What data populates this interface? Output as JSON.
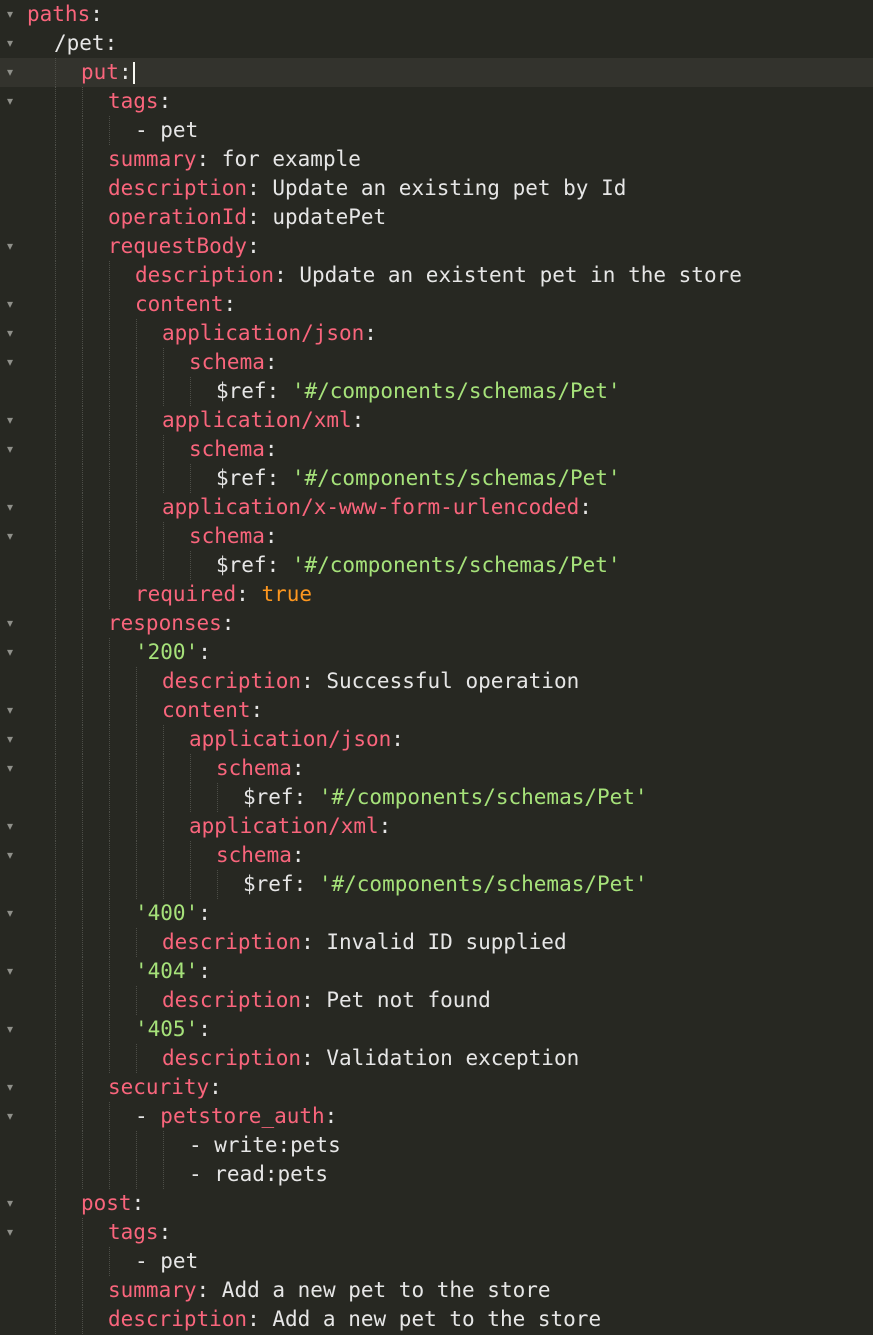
{
  "editor": {
    "language": "yaml",
    "theme": {
      "background": "#272822",
      "key": "#f9657c",
      "string": "#a6e27a",
      "boolean": "#fd971f",
      "text": "#e6e6e6"
    },
    "cursor_line": 2,
    "lines": [
      {
        "indent": 0,
        "fold": true,
        "parts": [
          {
            "t": "k",
            "v": "paths"
          },
          {
            "t": "p",
            "v": ":"
          }
        ]
      },
      {
        "indent": 1,
        "fold": true,
        "parts": [
          {
            "t": "p",
            "v": "/pet:"
          }
        ]
      },
      {
        "indent": 2,
        "fold": true,
        "parts": [
          {
            "t": "k",
            "v": "put"
          },
          {
            "t": "p",
            "v": ":"
          }
        ]
      },
      {
        "indent": 3,
        "fold": true,
        "parts": [
          {
            "t": "k",
            "v": "tags"
          },
          {
            "t": "p",
            "v": ":"
          }
        ]
      },
      {
        "indent": 4,
        "fold": false,
        "parts": [
          {
            "t": "p",
            "v": "- pet"
          }
        ]
      },
      {
        "indent": 3,
        "fold": false,
        "parts": [
          {
            "t": "k",
            "v": "summary"
          },
          {
            "t": "p",
            "v": ": for example"
          }
        ]
      },
      {
        "indent": 3,
        "fold": false,
        "parts": [
          {
            "t": "k",
            "v": "description"
          },
          {
            "t": "p",
            "v": ": Update an existing pet by Id"
          }
        ]
      },
      {
        "indent": 3,
        "fold": false,
        "parts": [
          {
            "t": "k",
            "v": "operationId"
          },
          {
            "t": "p",
            "v": ": updatePet"
          }
        ]
      },
      {
        "indent": 3,
        "fold": true,
        "parts": [
          {
            "t": "k",
            "v": "requestBody"
          },
          {
            "t": "p",
            "v": ":"
          }
        ]
      },
      {
        "indent": 4,
        "fold": false,
        "parts": [
          {
            "t": "k",
            "v": "description"
          },
          {
            "t": "p",
            "v": ": Update an existent pet in the store"
          }
        ]
      },
      {
        "indent": 4,
        "fold": true,
        "parts": [
          {
            "t": "k",
            "v": "content"
          },
          {
            "t": "p",
            "v": ":"
          }
        ]
      },
      {
        "indent": 5,
        "fold": true,
        "parts": [
          {
            "t": "k",
            "v": "application/json"
          },
          {
            "t": "p",
            "v": ":"
          }
        ]
      },
      {
        "indent": 6,
        "fold": true,
        "parts": [
          {
            "t": "k",
            "v": "schema"
          },
          {
            "t": "p",
            "v": ":"
          }
        ]
      },
      {
        "indent": 7,
        "fold": false,
        "parts": [
          {
            "t": "p",
            "v": "$ref: "
          },
          {
            "t": "s",
            "v": "'#/components/schemas/Pet'"
          }
        ]
      },
      {
        "indent": 5,
        "fold": true,
        "parts": [
          {
            "t": "k",
            "v": "application/xml"
          },
          {
            "t": "p",
            "v": ":"
          }
        ]
      },
      {
        "indent": 6,
        "fold": true,
        "parts": [
          {
            "t": "k",
            "v": "schema"
          },
          {
            "t": "p",
            "v": ":"
          }
        ]
      },
      {
        "indent": 7,
        "fold": false,
        "parts": [
          {
            "t": "p",
            "v": "$ref: "
          },
          {
            "t": "s",
            "v": "'#/components/schemas/Pet'"
          }
        ]
      },
      {
        "indent": 5,
        "fold": true,
        "parts": [
          {
            "t": "k",
            "v": "application/x-www-form-urlencoded"
          },
          {
            "t": "p",
            "v": ":"
          }
        ]
      },
      {
        "indent": 6,
        "fold": true,
        "parts": [
          {
            "t": "k",
            "v": "schema"
          },
          {
            "t": "p",
            "v": ":"
          }
        ]
      },
      {
        "indent": 7,
        "fold": false,
        "parts": [
          {
            "t": "p",
            "v": "$ref: "
          },
          {
            "t": "s",
            "v": "'#/components/schemas/Pet'"
          }
        ]
      },
      {
        "indent": 4,
        "fold": false,
        "parts": [
          {
            "t": "k",
            "v": "required"
          },
          {
            "t": "p",
            "v": ": "
          },
          {
            "t": "b",
            "v": "true"
          }
        ]
      },
      {
        "indent": 3,
        "fold": true,
        "parts": [
          {
            "t": "k",
            "v": "responses"
          },
          {
            "t": "p",
            "v": ":"
          }
        ]
      },
      {
        "indent": 4,
        "fold": true,
        "parts": [
          {
            "t": "s",
            "v": "'200'"
          },
          {
            "t": "p",
            "v": ":"
          }
        ]
      },
      {
        "indent": 5,
        "fold": false,
        "parts": [
          {
            "t": "k",
            "v": "description"
          },
          {
            "t": "p",
            "v": ": Successful operation"
          }
        ]
      },
      {
        "indent": 5,
        "fold": true,
        "parts": [
          {
            "t": "k",
            "v": "content"
          },
          {
            "t": "p",
            "v": ":"
          }
        ]
      },
      {
        "indent": 6,
        "fold": true,
        "parts": [
          {
            "t": "k",
            "v": "application/json"
          },
          {
            "t": "p",
            "v": ":"
          }
        ]
      },
      {
        "indent": 7,
        "fold": true,
        "parts": [
          {
            "t": "k",
            "v": "schema"
          },
          {
            "t": "p",
            "v": ":"
          }
        ]
      },
      {
        "indent": 8,
        "fold": false,
        "parts": [
          {
            "t": "p",
            "v": "$ref: "
          },
          {
            "t": "s",
            "v": "'#/components/schemas/Pet'"
          }
        ]
      },
      {
        "indent": 6,
        "fold": true,
        "parts": [
          {
            "t": "k",
            "v": "application/xml"
          },
          {
            "t": "p",
            "v": ":"
          }
        ]
      },
      {
        "indent": 7,
        "fold": true,
        "parts": [
          {
            "t": "k",
            "v": "schema"
          },
          {
            "t": "p",
            "v": ":"
          }
        ]
      },
      {
        "indent": 8,
        "fold": false,
        "parts": [
          {
            "t": "p",
            "v": "$ref: "
          },
          {
            "t": "s",
            "v": "'#/components/schemas/Pet'"
          }
        ]
      },
      {
        "indent": 4,
        "fold": true,
        "parts": [
          {
            "t": "s",
            "v": "'400'"
          },
          {
            "t": "p",
            "v": ":"
          }
        ]
      },
      {
        "indent": 5,
        "fold": false,
        "parts": [
          {
            "t": "k",
            "v": "description"
          },
          {
            "t": "p",
            "v": ": Invalid ID supplied"
          }
        ]
      },
      {
        "indent": 4,
        "fold": true,
        "parts": [
          {
            "t": "s",
            "v": "'404'"
          },
          {
            "t": "p",
            "v": ":"
          }
        ]
      },
      {
        "indent": 5,
        "fold": false,
        "parts": [
          {
            "t": "k",
            "v": "description"
          },
          {
            "t": "p",
            "v": ": Pet not found"
          }
        ]
      },
      {
        "indent": 4,
        "fold": true,
        "parts": [
          {
            "t": "s",
            "v": "'405'"
          },
          {
            "t": "p",
            "v": ":"
          }
        ]
      },
      {
        "indent": 5,
        "fold": false,
        "parts": [
          {
            "t": "k",
            "v": "description"
          },
          {
            "t": "p",
            "v": ": Validation exception"
          }
        ]
      },
      {
        "indent": 3,
        "fold": true,
        "parts": [
          {
            "t": "k",
            "v": "security"
          },
          {
            "t": "p",
            "v": ":"
          }
        ]
      },
      {
        "indent": 4,
        "fold": true,
        "parts": [
          {
            "t": "p",
            "v": "- "
          },
          {
            "t": "k",
            "v": "petstore_auth"
          },
          {
            "t": "p",
            "v": ":"
          }
        ]
      },
      {
        "indent": 6,
        "fold": false,
        "parts": [
          {
            "t": "p",
            "v": "- write:pets"
          }
        ]
      },
      {
        "indent": 6,
        "fold": false,
        "parts": [
          {
            "t": "p",
            "v": "- read:pets"
          }
        ]
      },
      {
        "indent": 2,
        "fold": true,
        "parts": [
          {
            "t": "k",
            "v": "post"
          },
          {
            "t": "p",
            "v": ":"
          }
        ]
      },
      {
        "indent": 3,
        "fold": true,
        "parts": [
          {
            "t": "k",
            "v": "tags"
          },
          {
            "t": "p",
            "v": ":"
          }
        ]
      },
      {
        "indent": 4,
        "fold": false,
        "parts": [
          {
            "t": "p",
            "v": "- pet"
          }
        ]
      },
      {
        "indent": 3,
        "fold": false,
        "parts": [
          {
            "t": "k",
            "v": "summary"
          },
          {
            "t": "p",
            "v": ": Add a new pet to the store"
          }
        ]
      },
      {
        "indent": 3,
        "fold": false,
        "parts": [
          {
            "t": "k",
            "v": "description"
          },
          {
            "t": "p",
            "v": ": Add a new pet to the store"
          }
        ]
      }
    ]
  }
}
